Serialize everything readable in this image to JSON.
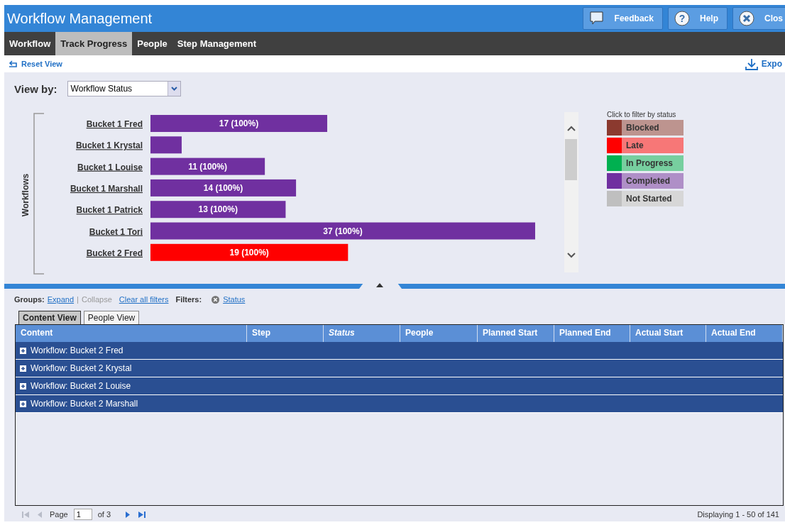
{
  "window": {
    "title": "Workflow Management"
  },
  "header_buttons": [
    {
      "label": "Feedback",
      "kind": "feedback"
    },
    {
      "label": "Help",
      "kind": "help",
      "icon": "?"
    },
    {
      "label": "Clos",
      "kind": "close"
    }
  ],
  "nav_tabs": [
    {
      "label": "Workflow",
      "selected": false
    },
    {
      "label": "Track Progress",
      "selected": true
    },
    {
      "label": "People",
      "selected": false
    },
    {
      "label": "Step Management",
      "selected": false
    }
  ],
  "toolbar": {
    "reset_view": "Reset View",
    "export": "Expo"
  },
  "view_by": {
    "label": "View by:",
    "value": "Workflow Status"
  },
  "chart": {
    "axis_label": "Workflows",
    "chart_data": {
      "type": "bar",
      "orientation": "horizontal",
      "stacked": true,
      "data_labels": true,
      "categories": [
        "Bucket 1 Fred",
        "Bucket 1 Krystal",
        "Bucket 1 Louise",
        "Bucket 1 Marshall",
        "Bucket 1 Patrick",
        "Bucket 1 Tori",
        "Bucket 2 Fred"
      ],
      "series": [
        {
          "color": "#ff0000",
          "values": [
            0,
            0,
            0,
            0,
            0,
            0,
            19
          ],
          "value_labels": [
            null,
            null,
            null,
            null,
            null,
            null,
            "19 (100%)"
          ]
        },
        {
          "color": "#7030a0",
          "values": [
            17,
            3,
            11,
            14,
            13,
            37,
            0
          ],
          "value_labels": [
            "17 (100%)",
            null,
            "11 (100%)",
            "14 (100%)",
            "13 (100%)",
            "37 (100%)",
            null
          ]
        }
      ]
    }
  },
  "legend": {
    "title": "Click to filter by status",
    "items": [
      {
        "label": "Blocked",
        "color": "#8b3a2f"
      },
      {
        "label": "Late",
        "color": "#ff0000"
      },
      {
        "label": "In Progress",
        "color": "#00b050"
      },
      {
        "label": "Completed",
        "color": "#7030a0"
      },
      {
        "label": "Not Started",
        "color": "#bfbfbf"
      }
    ]
  },
  "filters_bar": {
    "groups_label": "Groups:",
    "expand": "Expand",
    "separator": "|",
    "collapse": {
      "label": "Collapse",
      "disabled": true
    },
    "clear": "Clear all filters",
    "filters_label": "Filters:",
    "filters": [
      {
        "label": "Status"
      }
    ]
  },
  "view_tabs": [
    {
      "label": "Content View",
      "selected": true
    },
    {
      "label": "People View",
      "selected": false
    }
  ],
  "table": {
    "columns": [
      {
        "label": "Content",
        "sorted": false
      },
      {
        "label": "Step",
        "sorted": false
      },
      {
        "label": "Status",
        "sorted": true
      },
      {
        "label": "People",
        "sorted": false
      },
      {
        "label": "Planned Start",
        "sorted": false
      },
      {
        "label": "Planned End",
        "sorted": false
      },
      {
        "label": "Actual Start",
        "sorted": false
      },
      {
        "label": "Actual End",
        "sorted": false
      }
    ],
    "rows": [
      {
        "label": "Workflow: Bucket 2 Fred",
        "expanded": false
      },
      {
        "label": "Workflow: Bucket 2 Krystal",
        "expanded": false
      },
      {
        "label": "Workflow: Bucket 2 Louise",
        "expanded": false
      },
      {
        "label": "Workflow: Bucket 2 Marshall",
        "expanded": false
      }
    ]
  },
  "pager": {
    "first_disabled": true,
    "prev_disabled": true,
    "page_label": "Page",
    "page": "1",
    "of": "of 3",
    "display": "Displaying 1 - 50 of 141"
  }
}
